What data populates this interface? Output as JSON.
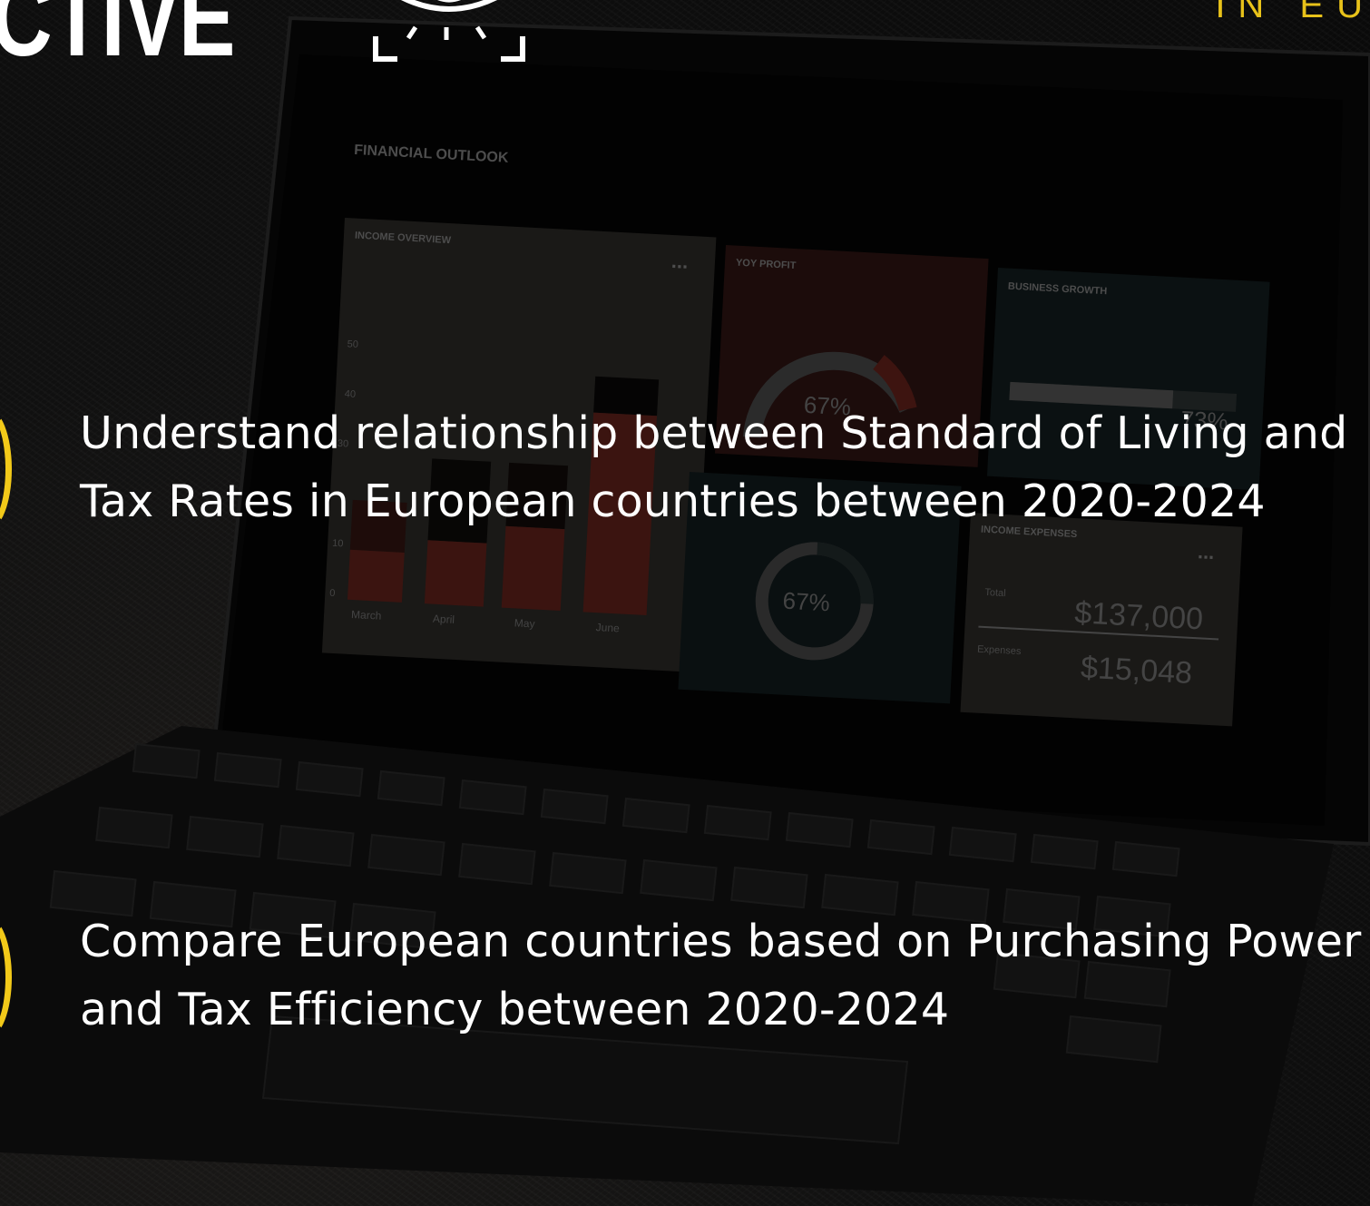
{
  "header": {
    "title_word": "CTIVE",
    "corner_text": "IN EU"
  },
  "screen": {
    "heading": "FINANCIAL OUTLOOK",
    "income_overview": {
      "label": "INCOME OVERVIEW",
      "y_ticks": [
        "50",
        "40",
        "30",
        "10",
        "0"
      ],
      "months": [
        "March",
        "April",
        "May",
        "June"
      ]
    },
    "yoy_profit": {
      "label": "YOY PROFIT",
      "percent": "67%"
    },
    "business_growth": {
      "label": "BUSINESS GROWTH",
      "percent": "73%"
    },
    "donut": {
      "percent": "67%"
    },
    "income_expenses": {
      "label": "INCOME EXPENSES",
      "total_label": "Total",
      "total_value": "$137,000",
      "expenses_label": "Expenses",
      "expenses_value": "$15,048"
    },
    "more_icon": "..."
  },
  "points": [
    {
      "text": "Understand relationship between Standard of Living and Tax Rates in European countries between 2020-2024"
    },
    {
      "text": "Compare European countries based on Purchasing Power and Tax Efficiency between 2020-2024"
    }
  ],
  "colors": {
    "accent": "#f2c919",
    "text": "#ffffff",
    "background": "#0d0d0d"
  }
}
